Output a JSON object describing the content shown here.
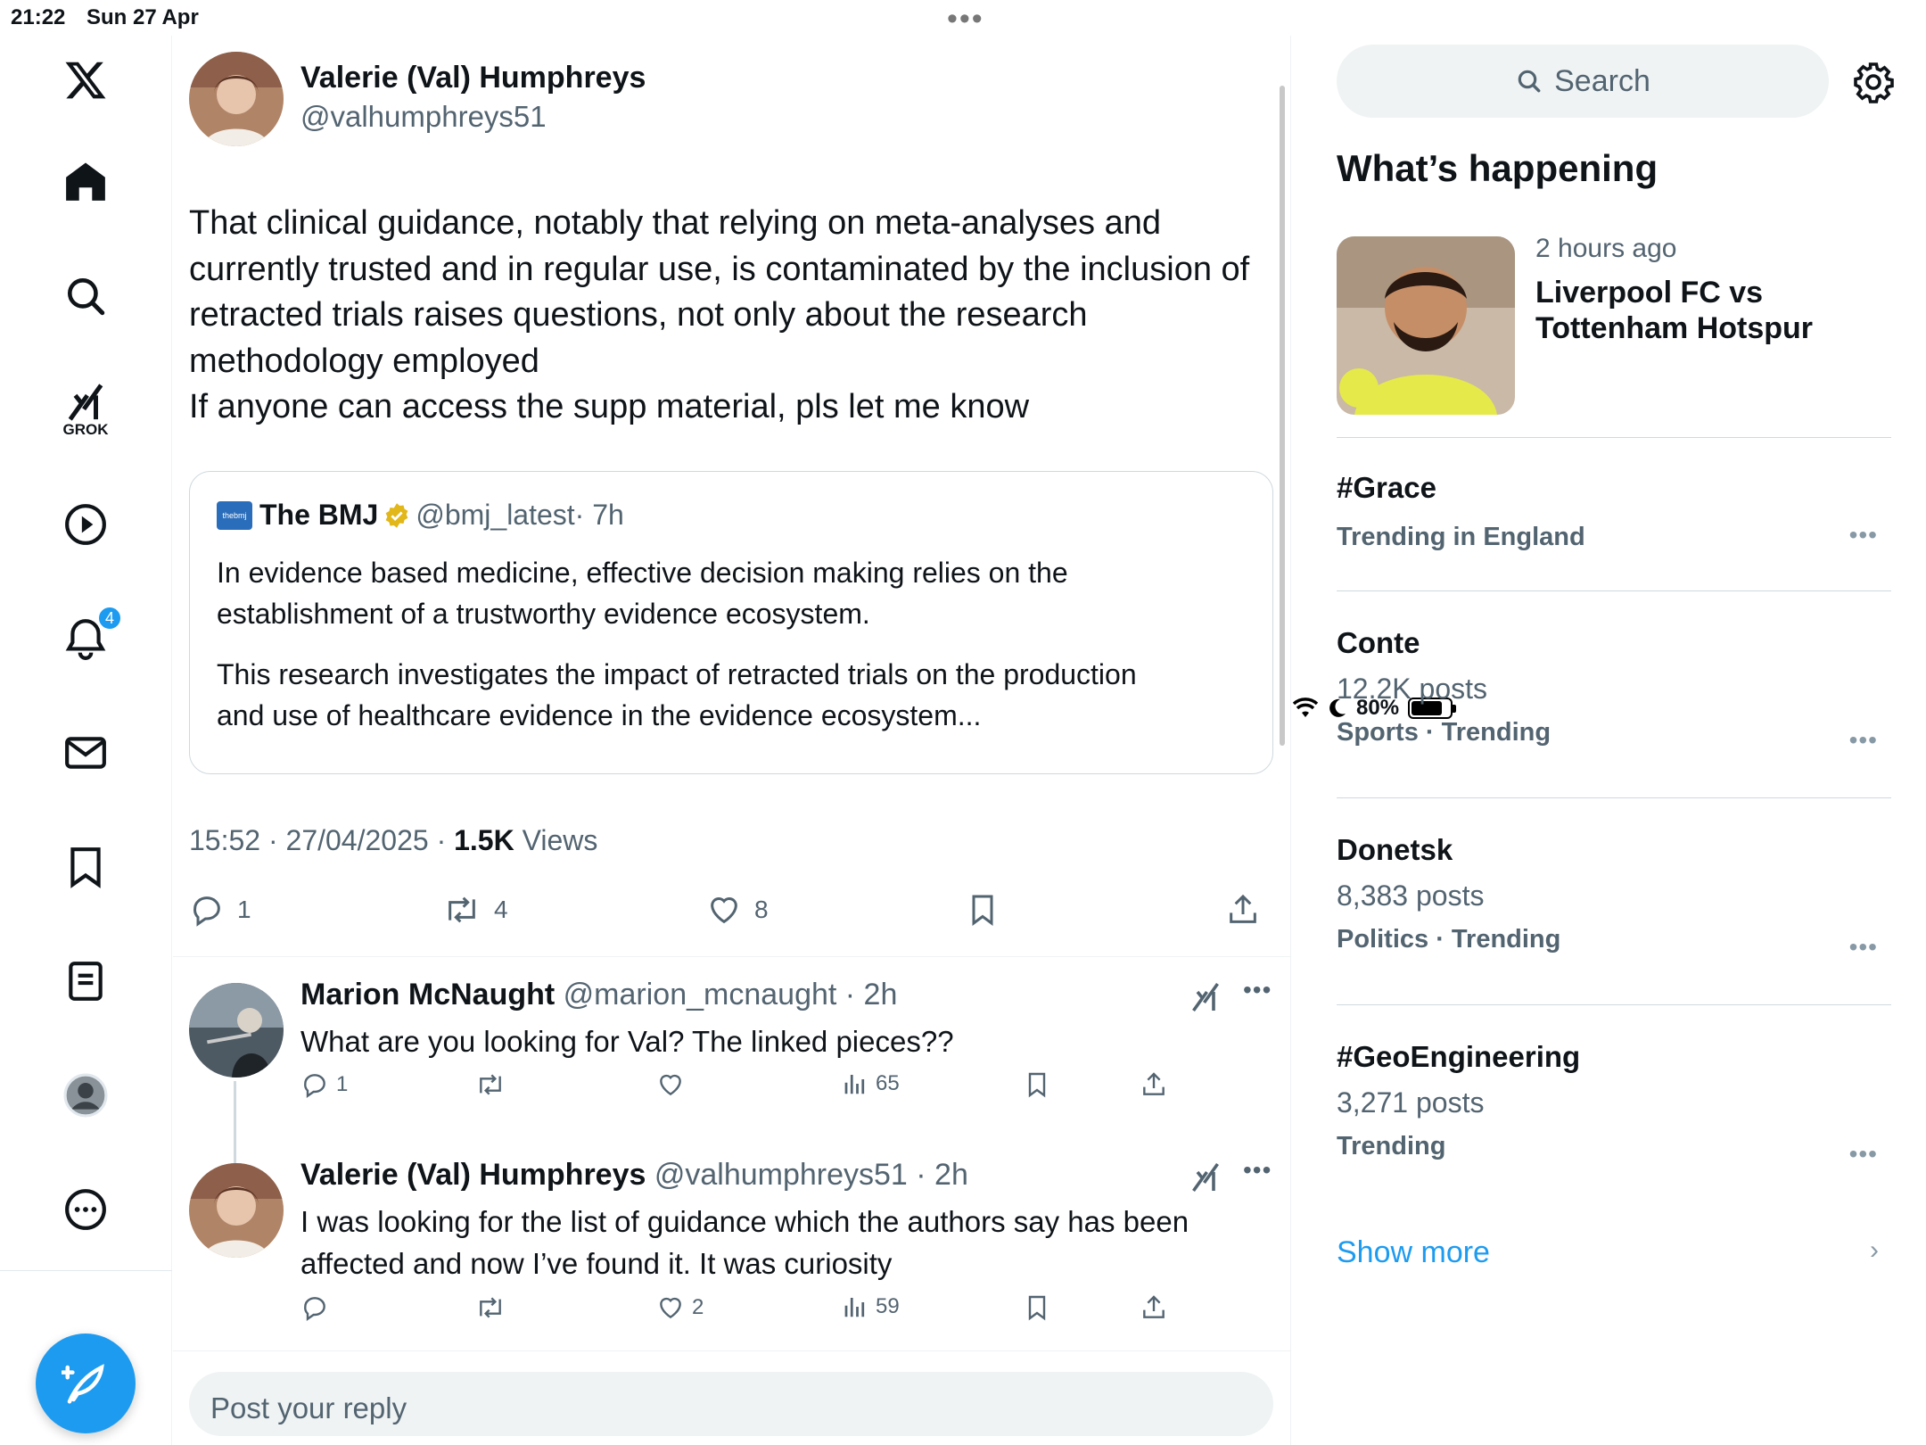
{
  "status": {
    "time": "21:22",
    "date": "Sun 27 Apr",
    "battery": "80%"
  },
  "nav": {
    "grok_label": "GROK",
    "notifications_badge": "4"
  },
  "tweet": {
    "author_name": "Valerie (Val) Humphreys",
    "author_handle": "@valhumphreys51",
    "text_lines": [
      "That clinical guidance, notably that relying on meta-analyses and",
      "currently trusted and in regular use, is contaminated by the inclusion of",
      "retracted trials raises questions, not only about the research",
      "methodology employed",
      "If anyone can access the supp material, pls let me know"
    ],
    "quote": {
      "logo_text": "thebmj",
      "name": "The BMJ",
      "handle": "@bmj_latest",
      "time": "· 7h",
      "line1": "In evidence based medicine, effective decision making relies on the",
      "line2": "establishment of a trustworthy evidence ecosystem.",
      "line3": "This research investigates the impact of retracted trials on the production",
      "line4": "and use of healthcare evidence in the evidence ecosystem..."
    },
    "timestamp": "15:52 · 27/04/2025 · ",
    "views_count": "1.5K",
    "views_label": " Views",
    "replies": "1",
    "retweets": "4",
    "likes": "8"
  },
  "replies": [
    {
      "name": "Marion McNaught",
      "handle": " @marion_mcnaught · 2h",
      "text": "What are you looking for Val? The linked pieces??",
      "replies": "1",
      "retweets": "",
      "likes": "",
      "views": "65"
    },
    {
      "name": "Valerie (Val) Humphreys",
      "handle": " @valhumphreys51 · 2h",
      "text1": "I was looking for the list of guidance which the authors say has been",
      "text2": "affected and now I’ve found it. It was curiosity",
      "replies": "",
      "retweets": "",
      "likes": "2",
      "views": "59"
    }
  ],
  "reply_box": {
    "placeholder": "Post your reply"
  },
  "sidebar": {
    "search_placeholder": "Search",
    "whats_happening": "What’s happening",
    "news": {
      "time": "2 hours ago",
      "title_line1": "Liverpool FC vs",
      "title_line2": "Tottenham Hotspur"
    },
    "trends": [
      {
        "name": "#Grace",
        "posts": "",
        "category": "Trending in England"
      },
      {
        "name": "Conte",
        "posts": "12.2K posts",
        "category": "Sports · Trending"
      },
      {
        "name": "Donetsk",
        "posts": "8,383 posts",
        "category": "Politics · Trending"
      },
      {
        "name": "#GeoEngineering",
        "posts": "3,271 posts",
        "category": "Trending"
      }
    ],
    "show_more": "Show more"
  },
  "colors": {
    "accent": "#1d9bf0",
    "text": "#0f1419",
    "muted": "#536471",
    "border": "#eff3f4"
  }
}
